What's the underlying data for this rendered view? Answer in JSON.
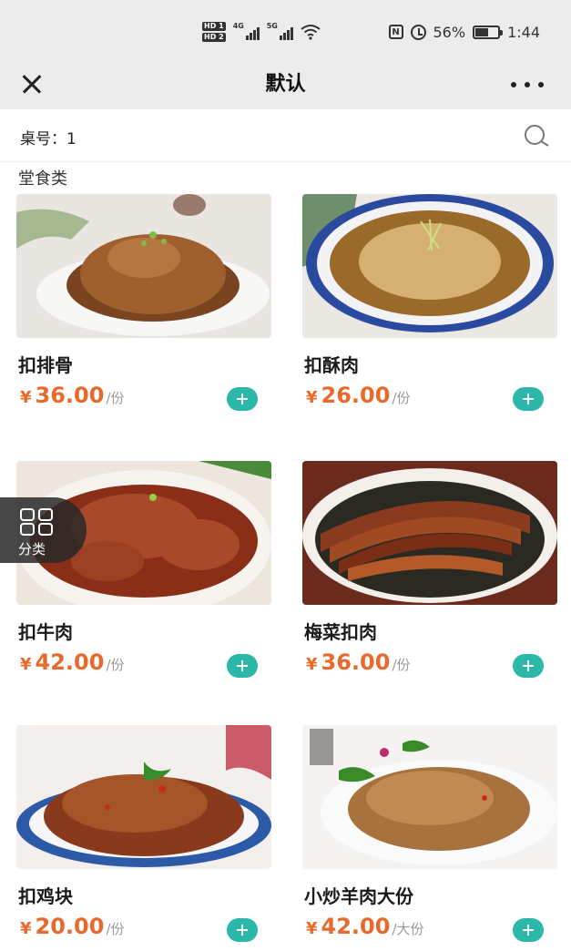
{
  "status_bar": {
    "hd1": "HD 1",
    "hd2": "HD 2",
    "network1": "4G",
    "network2": "5G",
    "nfc": "N",
    "battery": "56%",
    "time": "1:44"
  },
  "nav": {
    "title": "默认"
  },
  "table": {
    "label": "桌号：",
    "number": "1"
  },
  "section": {
    "title": "堂食类"
  },
  "dishes": [
    {
      "name": "扣排骨",
      "currency": "¥",
      "price": "36.00",
      "unit": "/份"
    },
    {
      "name": "扣酥肉",
      "currency": "¥",
      "price": "26.00",
      "unit": "/份"
    },
    {
      "name": "扣牛肉",
      "currency": "¥",
      "price": "42.00",
      "unit": "/份"
    },
    {
      "name": "梅菜扣肉",
      "currency": "¥",
      "price": "36.00",
      "unit": "/份"
    },
    {
      "name": "扣鸡块",
      "currency": "¥",
      "price": "20.00",
      "unit": "/份"
    },
    {
      "name": "小炒羊肉大份",
      "currency": "¥",
      "price": "42.00",
      "unit": "/大份"
    }
  ],
  "category_button": {
    "label": "分类"
  },
  "colors": {
    "price": "#e8692c",
    "add_button": "#2bb8a8",
    "header_bg": "#ececec"
  }
}
